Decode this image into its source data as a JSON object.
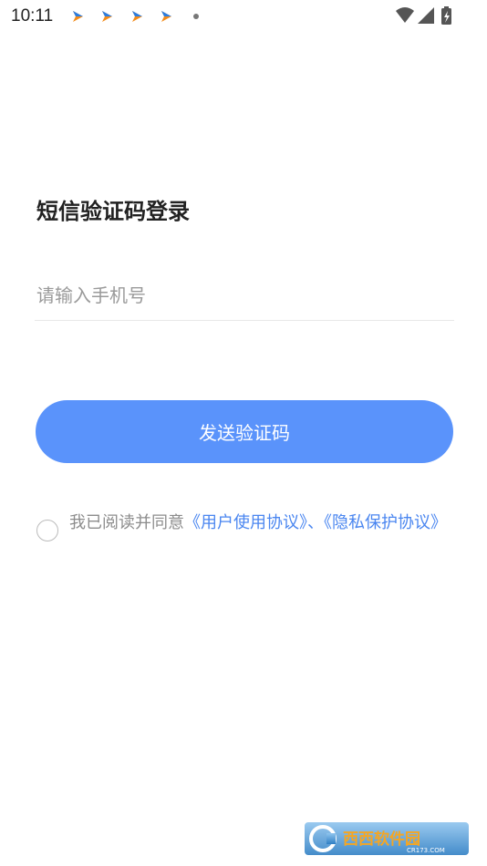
{
  "status_bar": {
    "time": "10:11"
  },
  "login": {
    "title": "短信验证码登录",
    "phone_placeholder": "请输入手机号",
    "send_button": "发送验证码"
  },
  "agreement": {
    "prefix": "我已阅读并同意",
    "user_agreement": "《用户使用协议》",
    "separator": "、",
    "privacy_policy": "《隐私保护协议》"
  },
  "watermark": {
    "text": "西西软件园",
    "subtext": "CR173.COM"
  },
  "colors": {
    "primary": "#5a93fb",
    "link": "#4a86f0",
    "placeholder": "#9a9a9a"
  },
  "icons": [
    "app-notification-icon",
    "wifi-icon",
    "signal-icon",
    "battery-charging-icon"
  ]
}
